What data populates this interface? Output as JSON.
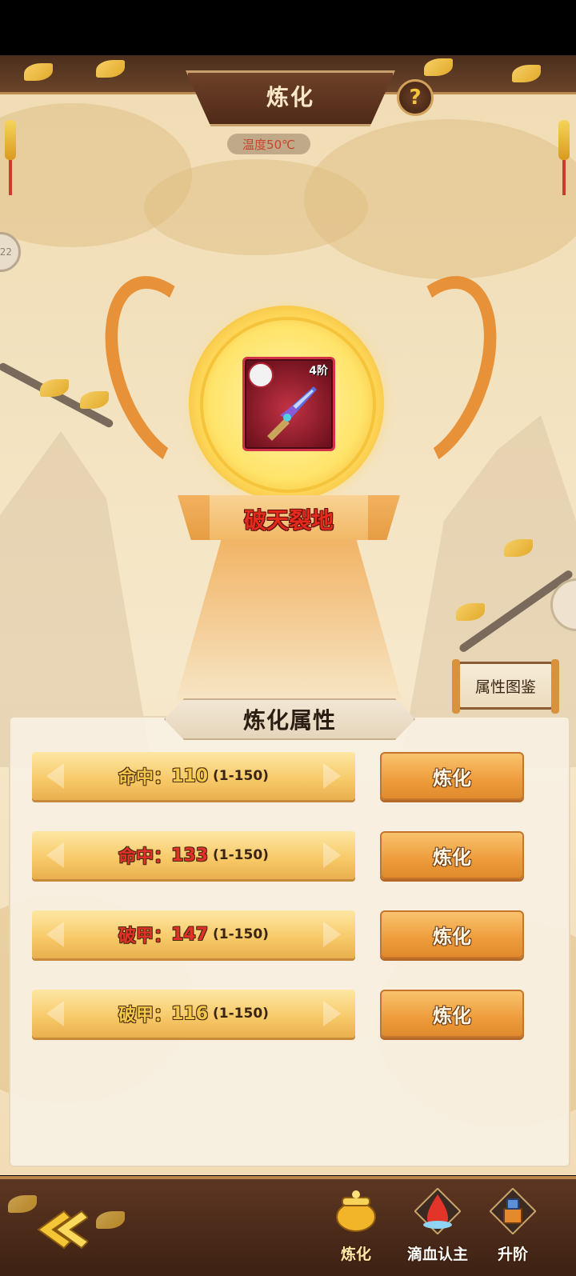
{
  "header": {
    "title": "炼化",
    "help_symbol": "?",
    "temperature": "温度50℃",
    "side_tab_left": "22"
  },
  "item": {
    "name": "破天裂地",
    "tier": "4阶"
  },
  "codex_button": "属性图鉴",
  "section_title": "炼化属性",
  "attributes": [
    {
      "name": "命中",
      "value": "110",
      "range": "(1-150)",
      "color": "#f2c94a",
      "button": "炼化"
    },
    {
      "name": "命中",
      "value": "133",
      "range": "(1-150)",
      "color": "#e4302b",
      "button": "炼化"
    },
    {
      "name": "破甲",
      "value": "147",
      "range": "(1-150)",
      "color": "#e4302b",
      "button": "炼化"
    },
    {
      "name": "破甲",
      "value": "116",
      "range": "(1-150)",
      "color": "#f2c94a",
      "button": "炼化"
    }
  ],
  "bottom_nav": [
    {
      "label": "炼化",
      "icon": "cauldron-icon",
      "active": true
    },
    {
      "label": "滴血认主",
      "icon": "blood-drop-icon",
      "active": false
    },
    {
      "label": "升阶",
      "icon": "upgrade-icon",
      "active": false
    }
  ],
  "colors": {
    "accent_orange": "#ee9c3b",
    "attr_gold": "#f2c94a",
    "attr_red": "#e4302b",
    "title_bar": "#4f2a18"
  }
}
